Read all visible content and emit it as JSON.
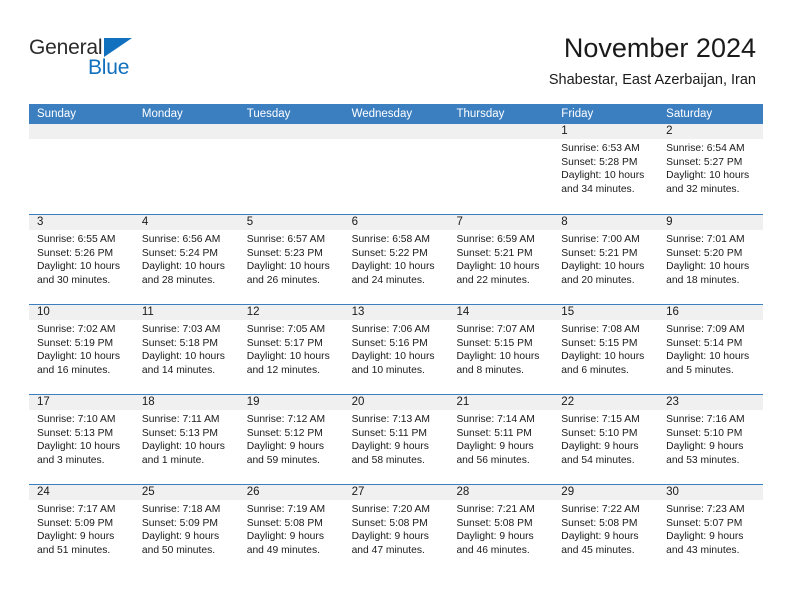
{
  "brand": {
    "name_top": "General",
    "name_bottom": "Blue",
    "accent_color": "#1271bf"
  },
  "header": {
    "title": "November 2024",
    "subtitle": "Shabestar, East Azerbaijan, Iran"
  },
  "calendar": {
    "header_bg": "#3c7fc1",
    "day_header_bg": "#f0f0f0",
    "weekday_headers": [
      "Sunday",
      "Monday",
      "Tuesday",
      "Wednesday",
      "Thursday",
      "Friday",
      "Saturday"
    ],
    "weeks": [
      [
        {
          "date": "",
          "lines": []
        },
        {
          "date": "",
          "lines": []
        },
        {
          "date": "",
          "lines": []
        },
        {
          "date": "",
          "lines": []
        },
        {
          "date": "",
          "lines": []
        },
        {
          "date": "1",
          "lines": [
            "Sunrise: 6:53 AM",
            "Sunset: 5:28 PM",
            "Daylight: 10 hours",
            "and 34 minutes."
          ]
        },
        {
          "date": "2",
          "lines": [
            "Sunrise: 6:54 AM",
            "Sunset: 5:27 PM",
            "Daylight: 10 hours",
            "and 32 minutes."
          ]
        }
      ],
      [
        {
          "date": "3",
          "lines": [
            "Sunrise: 6:55 AM",
            "Sunset: 5:26 PM",
            "Daylight: 10 hours",
            "and 30 minutes."
          ]
        },
        {
          "date": "4",
          "lines": [
            "Sunrise: 6:56 AM",
            "Sunset: 5:24 PM",
            "Daylight: 10 hours",
            "and 28 minutes."
          ]
        },
        {
          "date": "5",
          "lines": [
            "Sunrise: 6:57 AM",
            "Sunset: 5:23 PM",
            "Daylight: 10 hours",
            "and 26 minutes."
          ]
        },
        {
          "date": "6",
          "lines": [
            "Sunrise: 6:58 AM",
            "Sunset: 5:22 PM",
            "Daylight: 10 hours",
            "and 24 minutes."
          ]
        },
        {
          "date": "7",
          "lines": [
            "Sunrise: 6:59 AM",
            "Sunset: 5:21 PM",
            "Daylight: 10 hours",
            "and 22 minutes."
          ]
        },
        {
          "date": "8",
          "lines": [
            "Sunrise: 7:00 AM",
            "Sunset: 5:21 PM",
            "Daylight: 10 hours",
            "and 20 minutes."
          ]
        },
        {
          "date": "9",
          "lines": [
            "Sunrise: 7:01 AM",
            "Sunset: 5:20 PM",
            "Daylight: 10 hours",
            "and 18 minutes."
          ]
        }
      ],
      [
        {
          "date": "10",
          "lines": [
            "Sunrise: 7:02 AM",
            "Sunset: 5:19 PM",
            "Daylight: 10 hours",
            "and 16 minutes."
          ]
        },
        {
          "date": "11",
          "lines": [
            "Sunrise: 7:03 AM",
            "Sunset: 5:18 PM",
            "Daylight: 10 hours",
            "and 14 minutes."
          ]
        },
        {
          "date": "12",
          "lines": [
            "Sunrise: 7:05 AM",
            "Sunset: 5:17 PM",
            "Daylight: 10 hours",
            "and 12 minutes."
          ]
        },
        {
          "date": "13",
          "lines": [
            "Sunrise: 7:06 AM",
            "Sunset: 5:16 PM",
            "Daylight: 10 hours",
            "and 10 minutes."
          ]
        },
        {
          "date": "14",
          "lines": [
            "Sunrise: 7:07 AM",
            "Sunset: 5:15 PM",
            "Daylight: 10 hours",
            "and 8 minutes."
          ]
        },
        {
          "date": "15",
          "lines": [
            "Sunrise: 7:08 AM",
            "Sunset: 5:15 PM",
            "Daylight: 10 hours",
            "and 6 minutes."
          ]
        },
        {
          "date": "16",
          "lines": [
            "Sunrise: 7:09 AM",
            "Sunset: 5:14 PM",
            "Daylight: 10 hours",
            "and 5 minutes."
          ]
        }
      ],
      [
        {
          "date": "17",
          "lines": [
            "Sunrise: 7:10 AM",
            "Sunset: 5:13 PM",
            "Daylight: 10 hours",
            "and 3 minutes."
          ]
        },
        {
          "date": "18",
          "lines": [
            "Sunrise: 7:11 AM",
            "Sunset: 5:13 PM",
            "Daylight: 10 hours",
            "and 1 minute."
          ]
        },
        {
          "date": "19",
          "lines": [
            "Sunrise: 7:12 AM",
            "Sunset: 5:12 PM",
            "Daylight: 9 hours",
            "and 59 minutes."
          ]
        },
        {
          "date": "20",
          "lines": [
            "Sunrise: 7:13 AM",
            "Sunset: 5:11 PM",
            "Daylight: 9 hours",
            "and 58 minutes."
          ]
        },
        {
          "date": "21",
          "lines": [
            "Sunrise: 7:14 AM",
            "Sunset: 5:11 PM",
            "Daylight: 9 hours",
            "and 56 minutes."
          ]
        },
        {
          "date": "22",
          "lines": [
            "Sunrise: 7:15 AM",
            "Sunset: 5:10 PM",
            "Daylight: 9 hours",
            "and 54 minutes."
          ]
        },
        {
          "date": "23",
          "lines": [
            "Sunrise: 7:16 AM",
            "Sunset: 5:10 PM",
            "Daylight: 9 hours",
            "and 53 minutes."
          ]
        }
      ],
      [
        {
          "date": "24",
          "lines": [
            "Sunrise: 7:17 AM",
            "Sunset: 5:09 PM",
            "Daylight: 9 hours",
            "and 51 minutes."
          ]
        },
        {
          "date": "25",
          "lines": [
            "Sunrise: 7:18 AM",
            "Sunset: 5:09 PM",
            "Daylight: 9 hours",
            "and 50 minutes."
          ]
        },
        {
          "date": "26",
          "lines": [
            "Sunrise: 7:19 AM",
            "Sunset: 5:08 PM",
            "Daylight: 9 hours",
            "and 49 minutes."
          ]
        },
        {
          "date": "27",
          "lines": [
            "Sunrise: 7:20 AM",
            "Sunset: 5:08 PM",
            "Daylight: 9 hours",
            "and 47 minutes."
          ]
        },
        {
          "date": "28",
          "lines": [
            "Sunrise: 7:21 AM",
            "Sunset: 5:08 PM",
            "Daylight: 9 hours",
            "and 46 minutes."
          ]
        },
        {
          "date": "29",
          "lines": [
            "Sunrise: 7:22 AM",
            "Sunset: 5:08 PM",
            "Daylight: 9 hours",
            "and 45 minutes."
          ]
        },
        {
          "date": "30",
          "lines": [
            "Sunrise: 7:23 AM",
            "Sunset: 5:07 PM",
            "Daylight: 9 hours",
            "and 43 minutes."
          ]
        }
      ]
    ]
  }
}
